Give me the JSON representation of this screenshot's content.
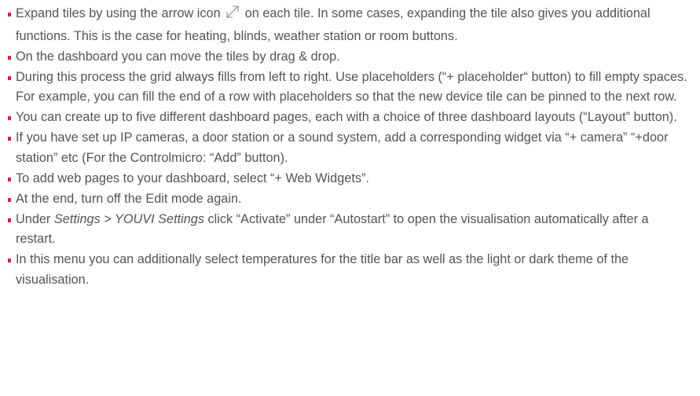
{
  "accent_color": "#d4213d",
  "text_color": "#545454",
  "bullets": [
    {
      "pre": "Expand tiles by using the arrow icon ",
      "icon": "expand-arrow-icon",
      "post": " on each tile. In some cases, expanding the tile also gives you additional functions. This is the case for heating, blinds, weather station or room buttons."
    },
    {
      "text": "On the dashboard you can move the tiles by drag & drop."
    },
    {
      "text": "During this process the grid always fills from left to right. Use placeholders (“+ placeholder“ button) to fill empty spaces. For example, you can fill the end of a row with placeholders so that the new device tile can be pinned to the next row."
    },
    {
      "text": "You can create up to five different dashboard pages, each with a choice of three dashboard layouts (“Layout” button)."
    },
    {
      "text": "If you have set up IP cameras, a door station or a sound system, add a corresponding widget via “+ camera” “+door station” etc (For the Controlmicro: “Add” button)."
    },
    {
      "text": "To add web pages to your dashboard, select “+ Web Widgets”."
    },
    {
      "text": "At the end, turn off the Edit mode again."
    },
    {
      "pre": "Under ",
      "ital": "Settings > YOUVI Settings",
      "post": " click “Activate” under “Autostart” to open the visualisation automatically after a restart."
    },
    {
      "text": "In this menu you can additionally select temperatures for the title bar as well as the light or dark theme of the visualisation."
    }
  ]
}
